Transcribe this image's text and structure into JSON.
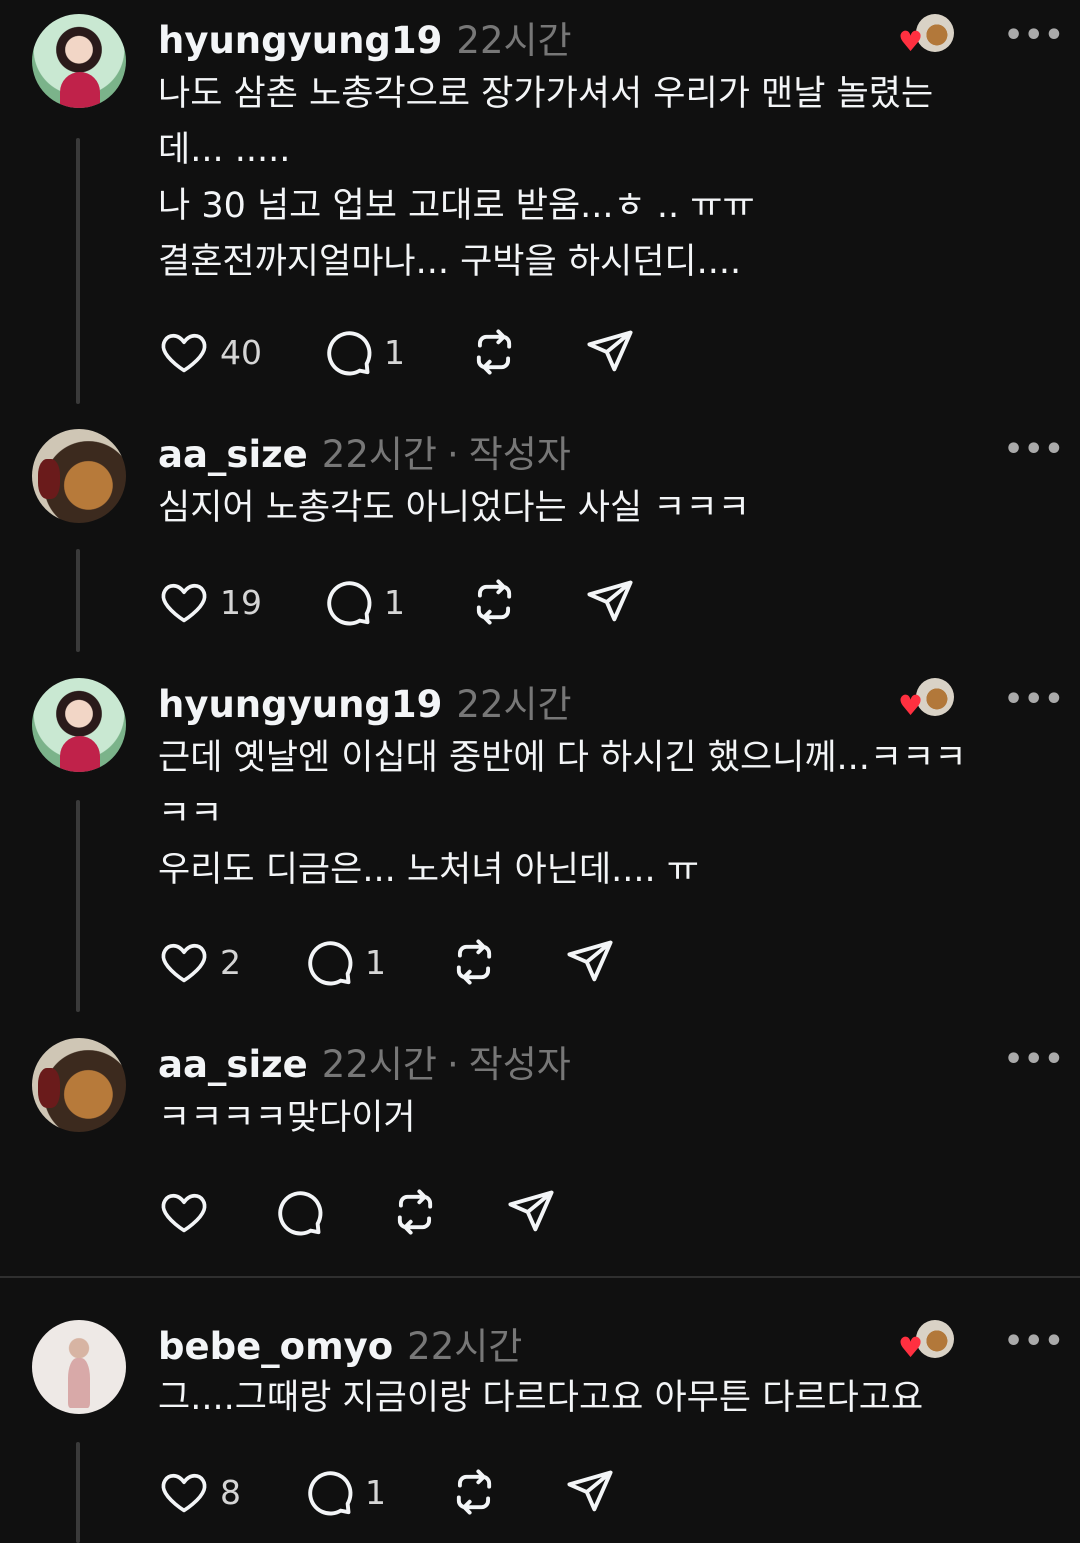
{
  "posts": [
    {
      "username": "hyungyung19",
      "time": "22시간",
      "lines": [
        "나도 삼촌 노총각으로 장가가셔서 우리가 맨날 놀렸는",
        "데... .....",
        "나 30 넘고 업보 고대로 받움...ㅎ .. ㅠㅠ",
        "결혼전까지얼마나... 구박을 하시던디...."
      ],
      "likes": "40",
      "replies": "1"
    },
    {
      "username": "aa_size",
      "time": "22시간",
      "separator": "·",
      "author_tag": "작성자",
      "lines": [
        "심지어 노총각도 아니었다는 사실 ㅋㅋㅋ"
      ],
      "likes": "19",
      "replies": "1"
    },
    {
      "username": "hyungyung19",
      "time": "22시간",
      "lines": [
        "근데 옛날엔 이십대 중반에 다 하시긴 했으니께...ㅋㅋㅋ",
        "ㅋㅋ",
        "우리도 디금은... 노처녀 아닌데.... ㅠ"
      ],
      "likes": "2",
      "replies": "1"
    },
    {
      "username": "aa_size",
      "time": "22시간",
      "separator": "·",
      "author_tag": "작성자",
      "lines": [
        "ㅋㅋㅋㅋ맞다이거"
      ],
      "likes": "",
      "replies": ""
    },
    {
      "username": "bebe_omyo",
      "time": "22시간",
      "lines": [
        "그....그때랑 지금이랑 다르다고요 아무튼 다르다고요"
      ],
      "likes": "8",
      "replies": "1"
    }
  ],
  "more_label": "•••",
  "heart_glyph": "♥",
  "colors": {
    "background": "#101010",
    "text": "#f3f5f7",
    "muted": "#777777",
    "like_red": "#ff3040"
  },
  "icons": [
    "heart-icon",
    "comment-icon",
    "repost-icon",
    "share-icon",
    "more-icon"
  ]
}
